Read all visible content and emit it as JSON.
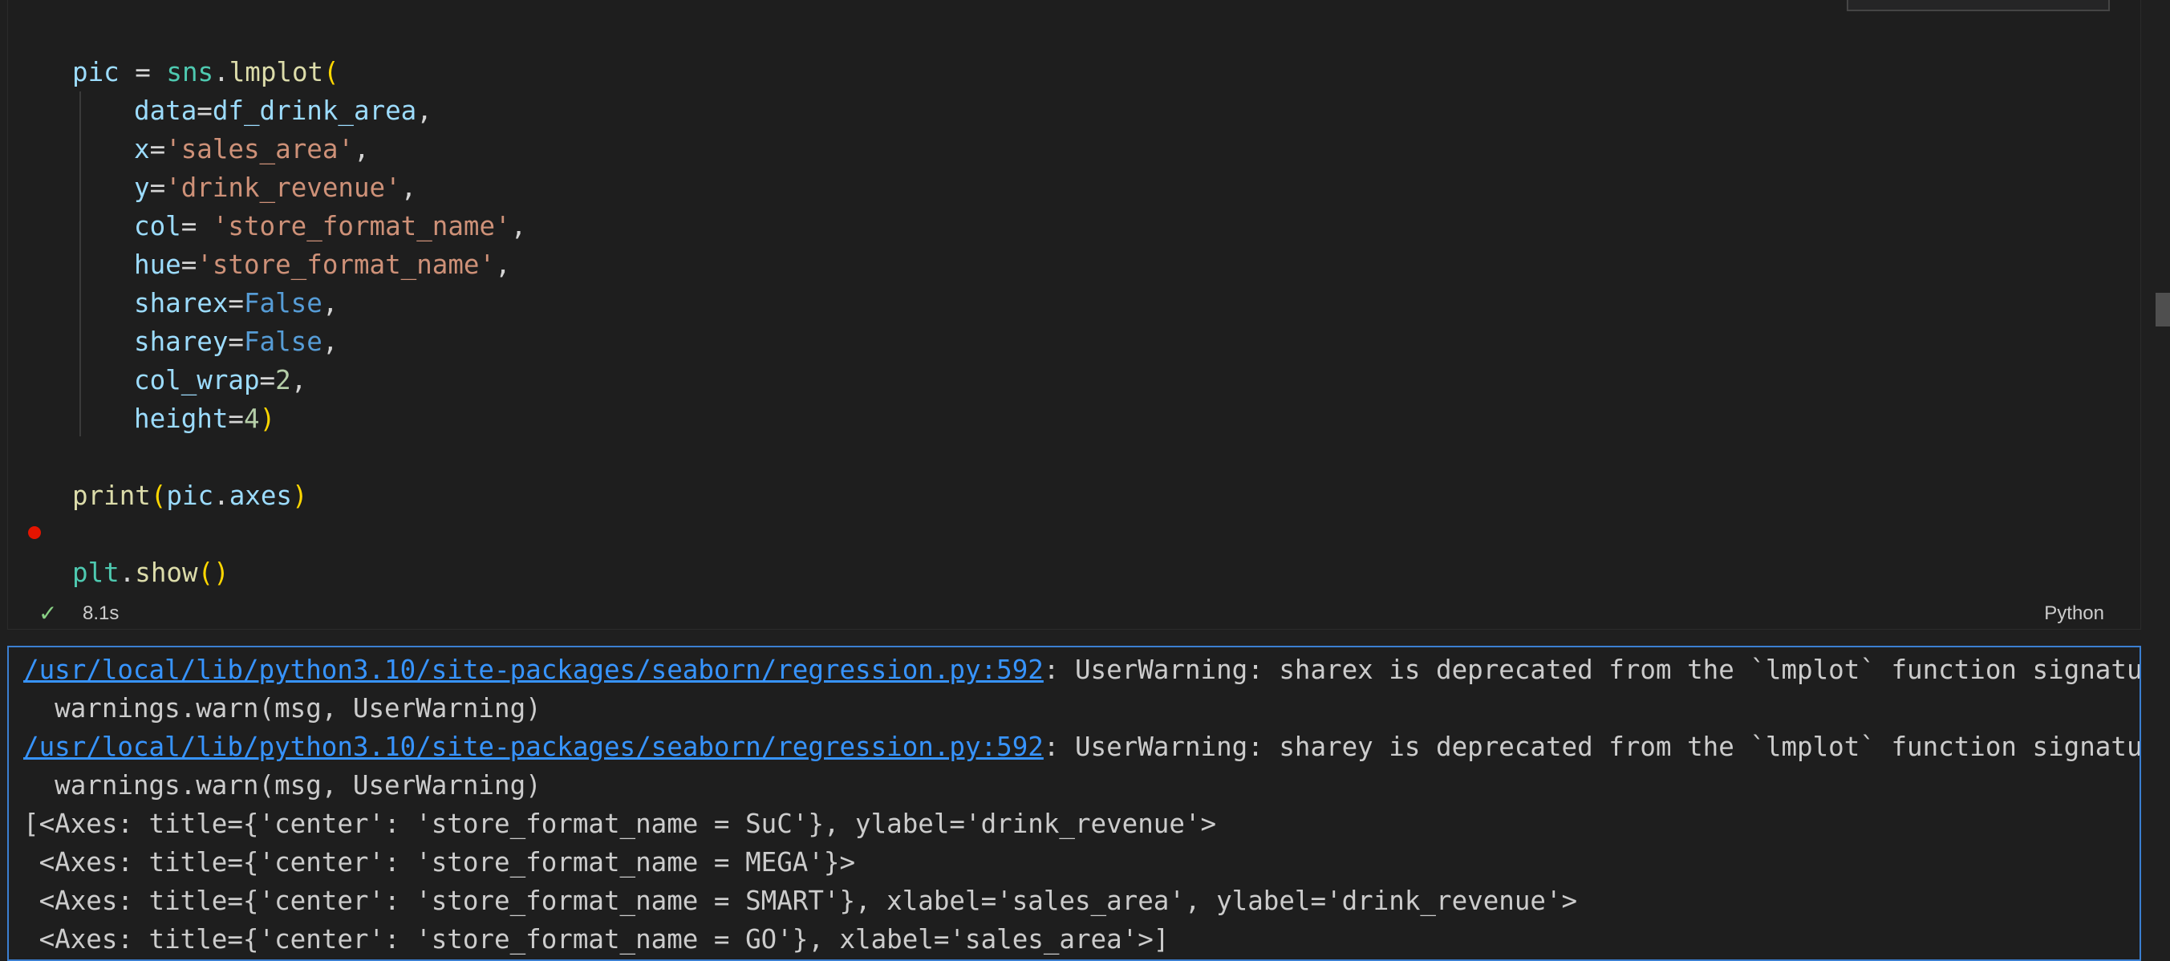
{
  "code": {
    "lines": [
      {
        "var": "pic",
        "eq": " = ",
        "mod": "sns",
        "dot": ".",
        "fn": "lmplot",
        "paren": "("
      },
      {
        "key": "data",
        "eq": "=",
        "val": "df_drink_area",
        "comma": ","
      },
      {
        "key": "x",
        "eq": "=",
        "val": "'sales_area'",
        "comma": ","
      },
      {
        "key": "y",
        "eq": "=",
        "val": "'drink_revenue'",
        "comma": ","
      },
      {
        "key": "col",
        "eq": "= ",
        "val": "'store_format_name'",
        "comma": ","
      },
      {
        "key": "hue",
        "eq": "=",
        "val": "'store_format_name'",
        "comma": ","
      },
      {
        "key": "sharex",
        "eq": "=",
        "val": "False",
        "comma": ","
      },
      {
        "key": "sharey",
        "eq": "=",
        "val": "False",
        "comma": ","
      },
      {
        "key": "col_wrap",
        "eq": "=",
        "val": "2",
        "comma": ","
      },
      {
        "key": "height",
        "eq": "=",
        "val": "4",
        "close": ")"
      },
      {
        "fn": "print",
        "open": "(",
        "var": "pic",
        "dot": ".",
        "attr": "axes",
        "close": ")"
      },
      {
        "mod": "plt",
        "dot": ".",
        "fn": "show",
        "paren": "()"
      }
    ]
  },
  "status": {
    "icon": "check-icon",
    "check": "✓",
    "time": "8.1s",
    "language": "Python"
  },
  "output": {
    "warnings": [
      {
        "path": "/usr/local/lib/python3.10/site-packages/seaborn/regression.py:592",
        "message": ": UserWarning: sharex is deprecated from the `lmplot` function signature",
        "detail": "  warnings.warn(msg, UserWarning)"
      },
      {
        "path": "/usr/local/lib/python3.10/site-packages/seaborn/regression.py:592",
        "message": ": UserWarning: sharey is deprecated from the `lmplot` function signature",
        "detail": "  warnings.warn(msg, UserWarning)"
      }
    ],
    "axes": [
      "[<Axes: title={'center': 'store_format_name = SuC'}, ylabel='drink_revenue'>",
      " <Axes: title={'center': 'store_format_name = MEGA'}>",
      " <Axes: title={'center': 'store_format_name = SMART'}, xlabel='sales_area', ylabel='drink_revenue'>",
      " <Axes: title={'center': 'store_format_name = GO'}, xlabel='sales_area'>]"
    ]
  },
  "colors": {
    "accent": "#3b7fd1",
    "link": "#3794ff",
    "success": "#89d185",
    "breakpoint": "#e51400"
  }
}
